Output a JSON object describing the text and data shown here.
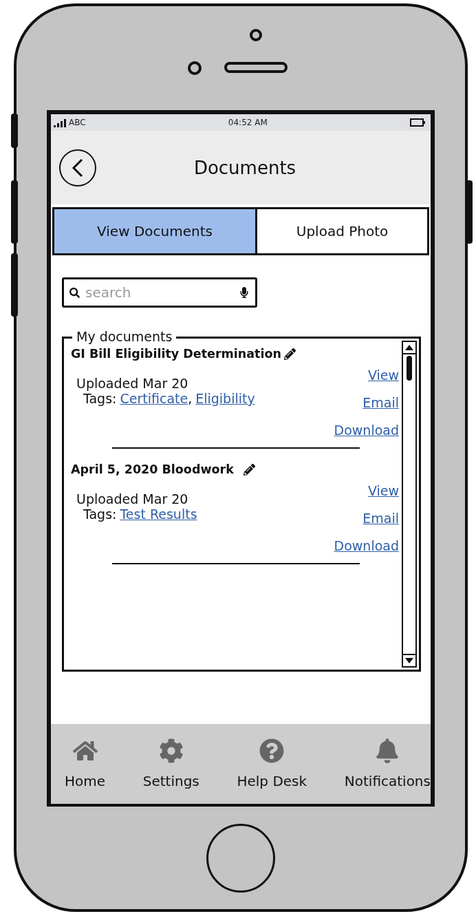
{
  "status_bar": {
    "carrier": "ABC",
    "time": "04:52 AM"
  },
  "header": {
    "title": "Documents"
  },
  "tabs": [
    {
      "label": "View Documents",
      "selected": true
    },
    {
      "label": "Upload Photo",
      "selected": false
    }
  ],
  "search": {
    "placeholder": "search"
  },
  "documents_group": {
    "legend": "My documents",
    "separator": ",",
    "items": [
      {
        "title": "GI Bill Eligibility Determination",
        "uploaded": "Uploaded Mar 20",
        "tags_label": "Tags:",
        "tags": [
          "Certificate",
          "Eligibility"
        ],
        "actions": [
          "View",
          "Email",
          "Download"
        ]
      },
      {
        "title": "April 5, 2020 Bloodwork",
        "uploaded": "Uploaded Mar 20",
        "tags_label": "Tags:",
        "tags": [
          "Test Results"
        ],
        "actions": [
          "View",
          "Email",
          "Download"
        ]
      }
    ]
  },
  "nav": [
    {
      "label": "Home"
    },
    {
      "label": "Settings"
    },
    {
      "label": "Help Desk"
    },
    {
      "label": "Notifications"
    }
  ]
}
